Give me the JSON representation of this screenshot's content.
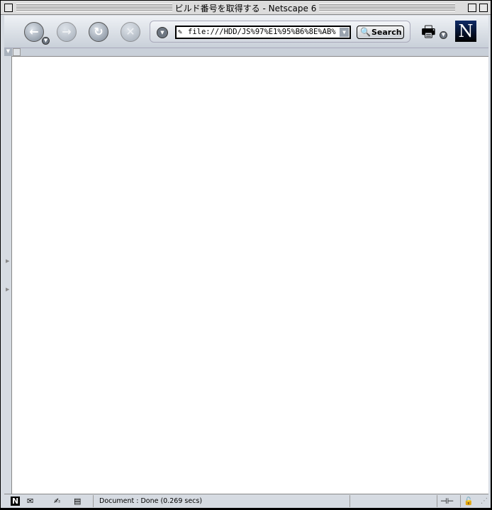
{
  "window": {
    "title": "ビルド番号を取得する - Netscape 6"
  },
  "toolbar": {
    "back": "←",
    "forward": "→",
    "reload": "↻",
    "stop": "✕",
    "url": "file:///HDD/JS%97%E1%95%B6%8E%AB%",
    "search_label": "Search"
  },
  "status": {
    "text": "Document : Done (0.269 secs)"
  },
  "logo": {
    "letter": "N"
  },
  "colors": {
    "frame": "#d6dbe2",
    "logo_bg": "#0e2a66"
  }
}
